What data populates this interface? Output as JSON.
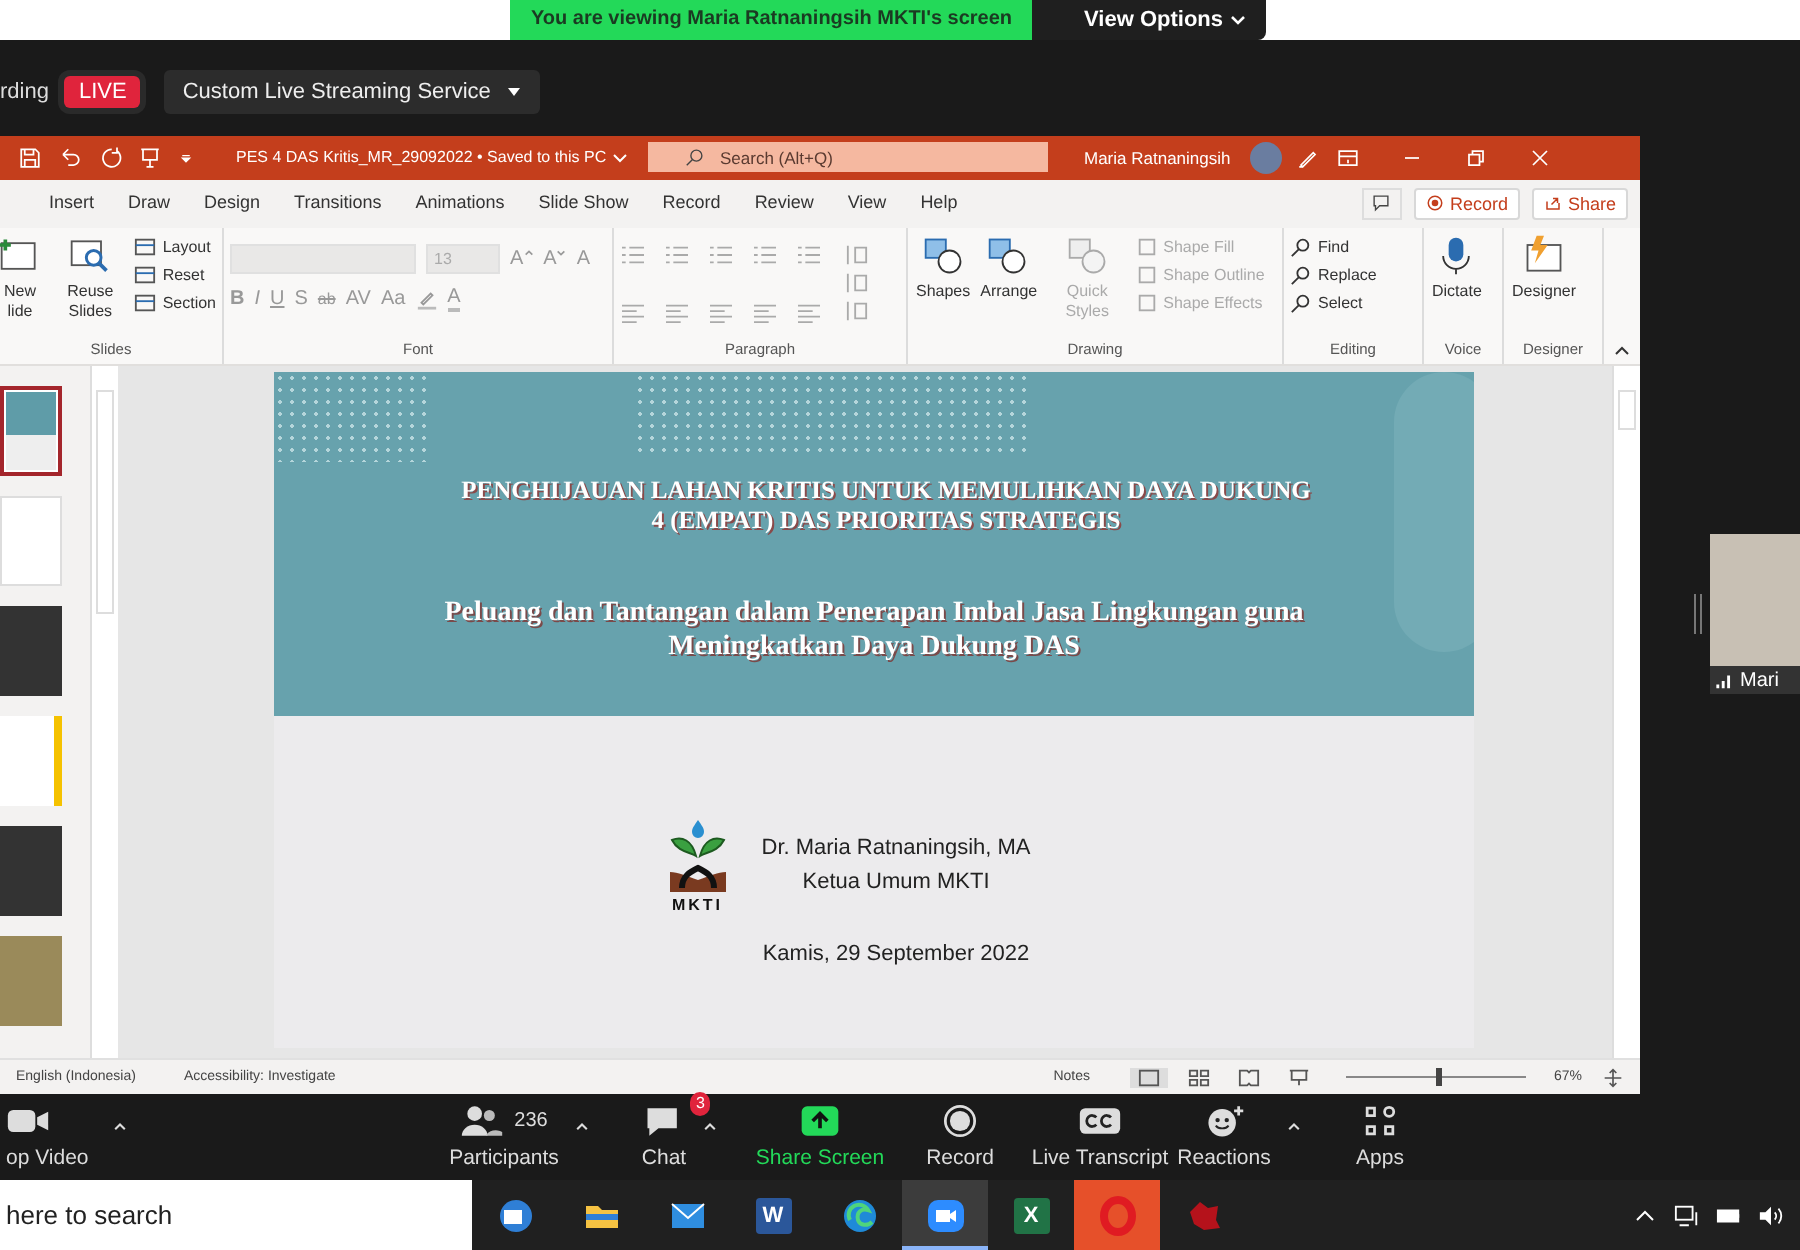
{
  "share_banner": {
    "text": "You are viewing Maria Ratnaningsih MKTI's screen",
    "view_options": "View Options"
  },
  "stream_bar": {
    "recording_label": "rding",
    "live_badge": "LIVE",
    "service": "Custom Live Streaming Service"
  },
  "powerpoint": {
    "title_bar": {
      "file_name": "PES 4 DAS Kritis_MR_29092022 • Saved to this PC",
      "search_placeholder": "Search (Alt+Q)",
      "user_name": "Maria Ratnaningsih"
    },
    "tabs": [
      {
        "label": "Insert",
        "selected": false
      },
      {
        "label": "Draw",
        "selected": false
      },
      {
        "label": "Design",
        "selected": false
      },
      {
        "label": "Transitions",
        "selected": false
      },
      {
        "label": "Animations",
        "selected": false
      },
      {
        "label": "Slide Show",
        "selected": false
      },
      {
        "label": "Record",
        "selected": false
      },
      {
        "label": "Review",
        "selected": false
      },
      {
        "label": "View",
        "selected": false
      },
      {
        "label": "Help",
        "selected": false
      }
    ],
    "record_button": "Record",
    "share_button": "Share",
    "ribbon": {
      "slides": {
        "label": "Slides",
        "new_slide": "New lide",
        "reuse": "Reuse Slides",
        "small": [
          "Layout",
          "Reset",
          "Section"
        ]
      },
      "font": {
        "label": "Font",
        "size": "13",
        "grow": "A",
        "shrink": "A",
        "clear": "A",
        "styles": [
          "B",
          "I",
          "U",
          "S",
          "ab",
          "AV",
          "Aa"
        ],
        "text_color_button": "A",
        "disabled": true
      },
      "paragraph": {
        "label": "Paragraph",
        "disabled": true
      },
      "drawing": {
        "label": "Drawing",
        "items": [
          {
            "label": "Shapes",
            "disabled": false
          },
          {
            "label": "Arrange",
            "disabled": false
          },
          {
            "label": "Quick Styles",
            "disabled": true
          }
        ],
        "small": [
          {
            "label": "Shape Fill",
            "disabled": true
          },
          {
            "label": "Shape Outline",
            "disabled": true
          },
          {
            "label": "Shape Effects",
            "disabled": true
          }
        ]
      },
      "editing": {
        "label": "Editing",
        "items": [
          "Find",
          "Replace",
          "Select"
        ]
      },
      "voice": {
        "label": "Voice",
        "button": "Dictate"
      },
      "designer": {
        "label": "Designer",
        "button": "Designer"
      }
    },
    "thumbnails": [
      {
        "selected": true
      },
      {
        "selected": false
      },
      {
        "selected": false
      },
      {
        "selected": false
      },
      {
        "selected": false
      },
      {
        "selected": false
      }
    ],
    "slide": {
      "title_lines": [
        "PENGHIJAUAN LAHAN KRITIS UNTUK MEMULIHKAN DAYA DUKUNG",
        "4 (EMPAT) DAS PRIORITAS STRATEGIS"
      ],
      "subtitle_lines": [
        "Peluang dan Tantangan dalam Penerapan Imbal Jasa Lingkungan guna",
        "Meningkatkan Daya Dukung DAS"
      ],
      "logo_text": "MKTI",
      "presenter": "Dr. Maria Ratnaningsih, MA",
      "role": "Ketua Umum MKTI",
      "date": "Kamis, 29 September 2022"
    },
    "status_bar": {
      "language": "English (Indonesia)",
      "accessibility": "Accessibility: Investigate",
      "notes": "Notes",
      "zoom": {
        "level": 0.5,
        "reading": "67%"
      }
    }
  },
  "participant": {
    "name": "Mari"
  },
  "meeting_toolbar": [
    {
      "kind": "video",
      "label": "op Video",
      "menu": true
    },
    {
      "kind": "participants",
      "label": "Participants",
      "count": "236",
      "menu": true
    },
    {
      "kind": "chat",
      "label": "Chat",
      "badge": "3",
      "menu": true
    },
    {
      "kind": "share",
      "label": "Share Screen",
      "menu": false
    },
    {
      "kind": "record",
      "label": "Record",
      "menu": false
    },
    {
      "kind": "captions",
      "label": "Live Transcript",
      "menu": false
    },
    {
      "kind": "reactions",
      "label": "Reactions",
      "menu": true
    },
    {
      "kind": "apps",
      "label": "Apps",
      "menu": false
    }
  ],
  "taskbar": {
    "search_placeholder": "here to search",
    "apps": [
      {
        "kind": "outlook",
        "selected": false
      },
      {
        "kind": "folder",
        "selected": false
      },
      {
        "kind": "mail",
        "selected": false
      },
      {
        "kind": "word",
        "letter": "W",
        "selected": false
      },
      {
        "kind": "edge",
        "selected": false
      },
      {
        "kind": "zoom",
        "selected": true
      },
      {
        "kind": "excel",
        "letter": "X",
        "selected": false
      },
      {
        "kind": "opera",
        "selected": false
      },
      {
        "kind": "game",
        "selected": false
      }
    ]
  }
}
